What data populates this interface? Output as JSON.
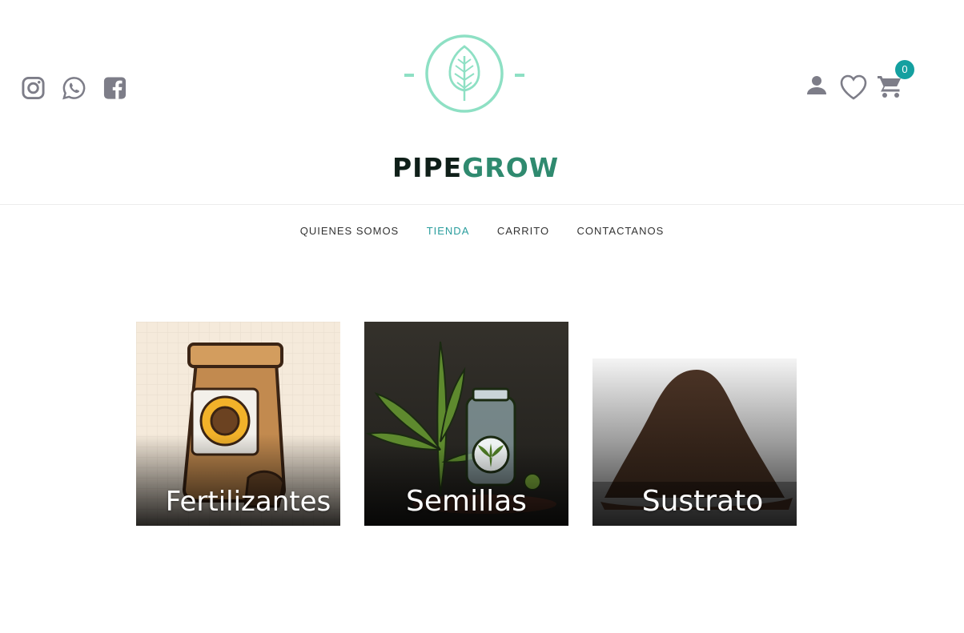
{
  "brand": {
    "part1": "PIPE",
    "part2": "GROW",
    "color_dark": "#0f1f19",
    "color_accent": "#2f8a6f",
    "leaf_color": "#8ee0c4"
  },
  "social": [
    {
      "name": "instagram-icon"
    },
    {
      "name": "whatsapp-icon"
    },
    {
      "name": "facebook-icon"
    }
  ],
  "header_icons": {
    "user": "user-icon",
    "wishlist": "heart-icon",
    "cart": "cart-icon",
    "cart_count": "0",
    "badge_color": "#14a0a0"
  },
  "nav": {
    "items": [
      {
        "label": "QUIENES SOMOS",
        "active": false
      },
      {
        "label": "TIENDA",
        "active": true
      },
      {
        "label": "CARRITO",
        "active": false
      },
      {
        "label": "CONTACTANOS",
        "active": false
      }
    ]
  },
  "categories": [
    {
      "label": "Fertilizantes",
      "image": "fertilizer-bag-illustration"
    },
    {
      "label": "Semillas",
      "image": "cannabis-leaf-and-seed-jar-illustration"
    },
    {
      "label": "Sustrato",
      "image": "soil-pile-photo"
    }
  ]
}
